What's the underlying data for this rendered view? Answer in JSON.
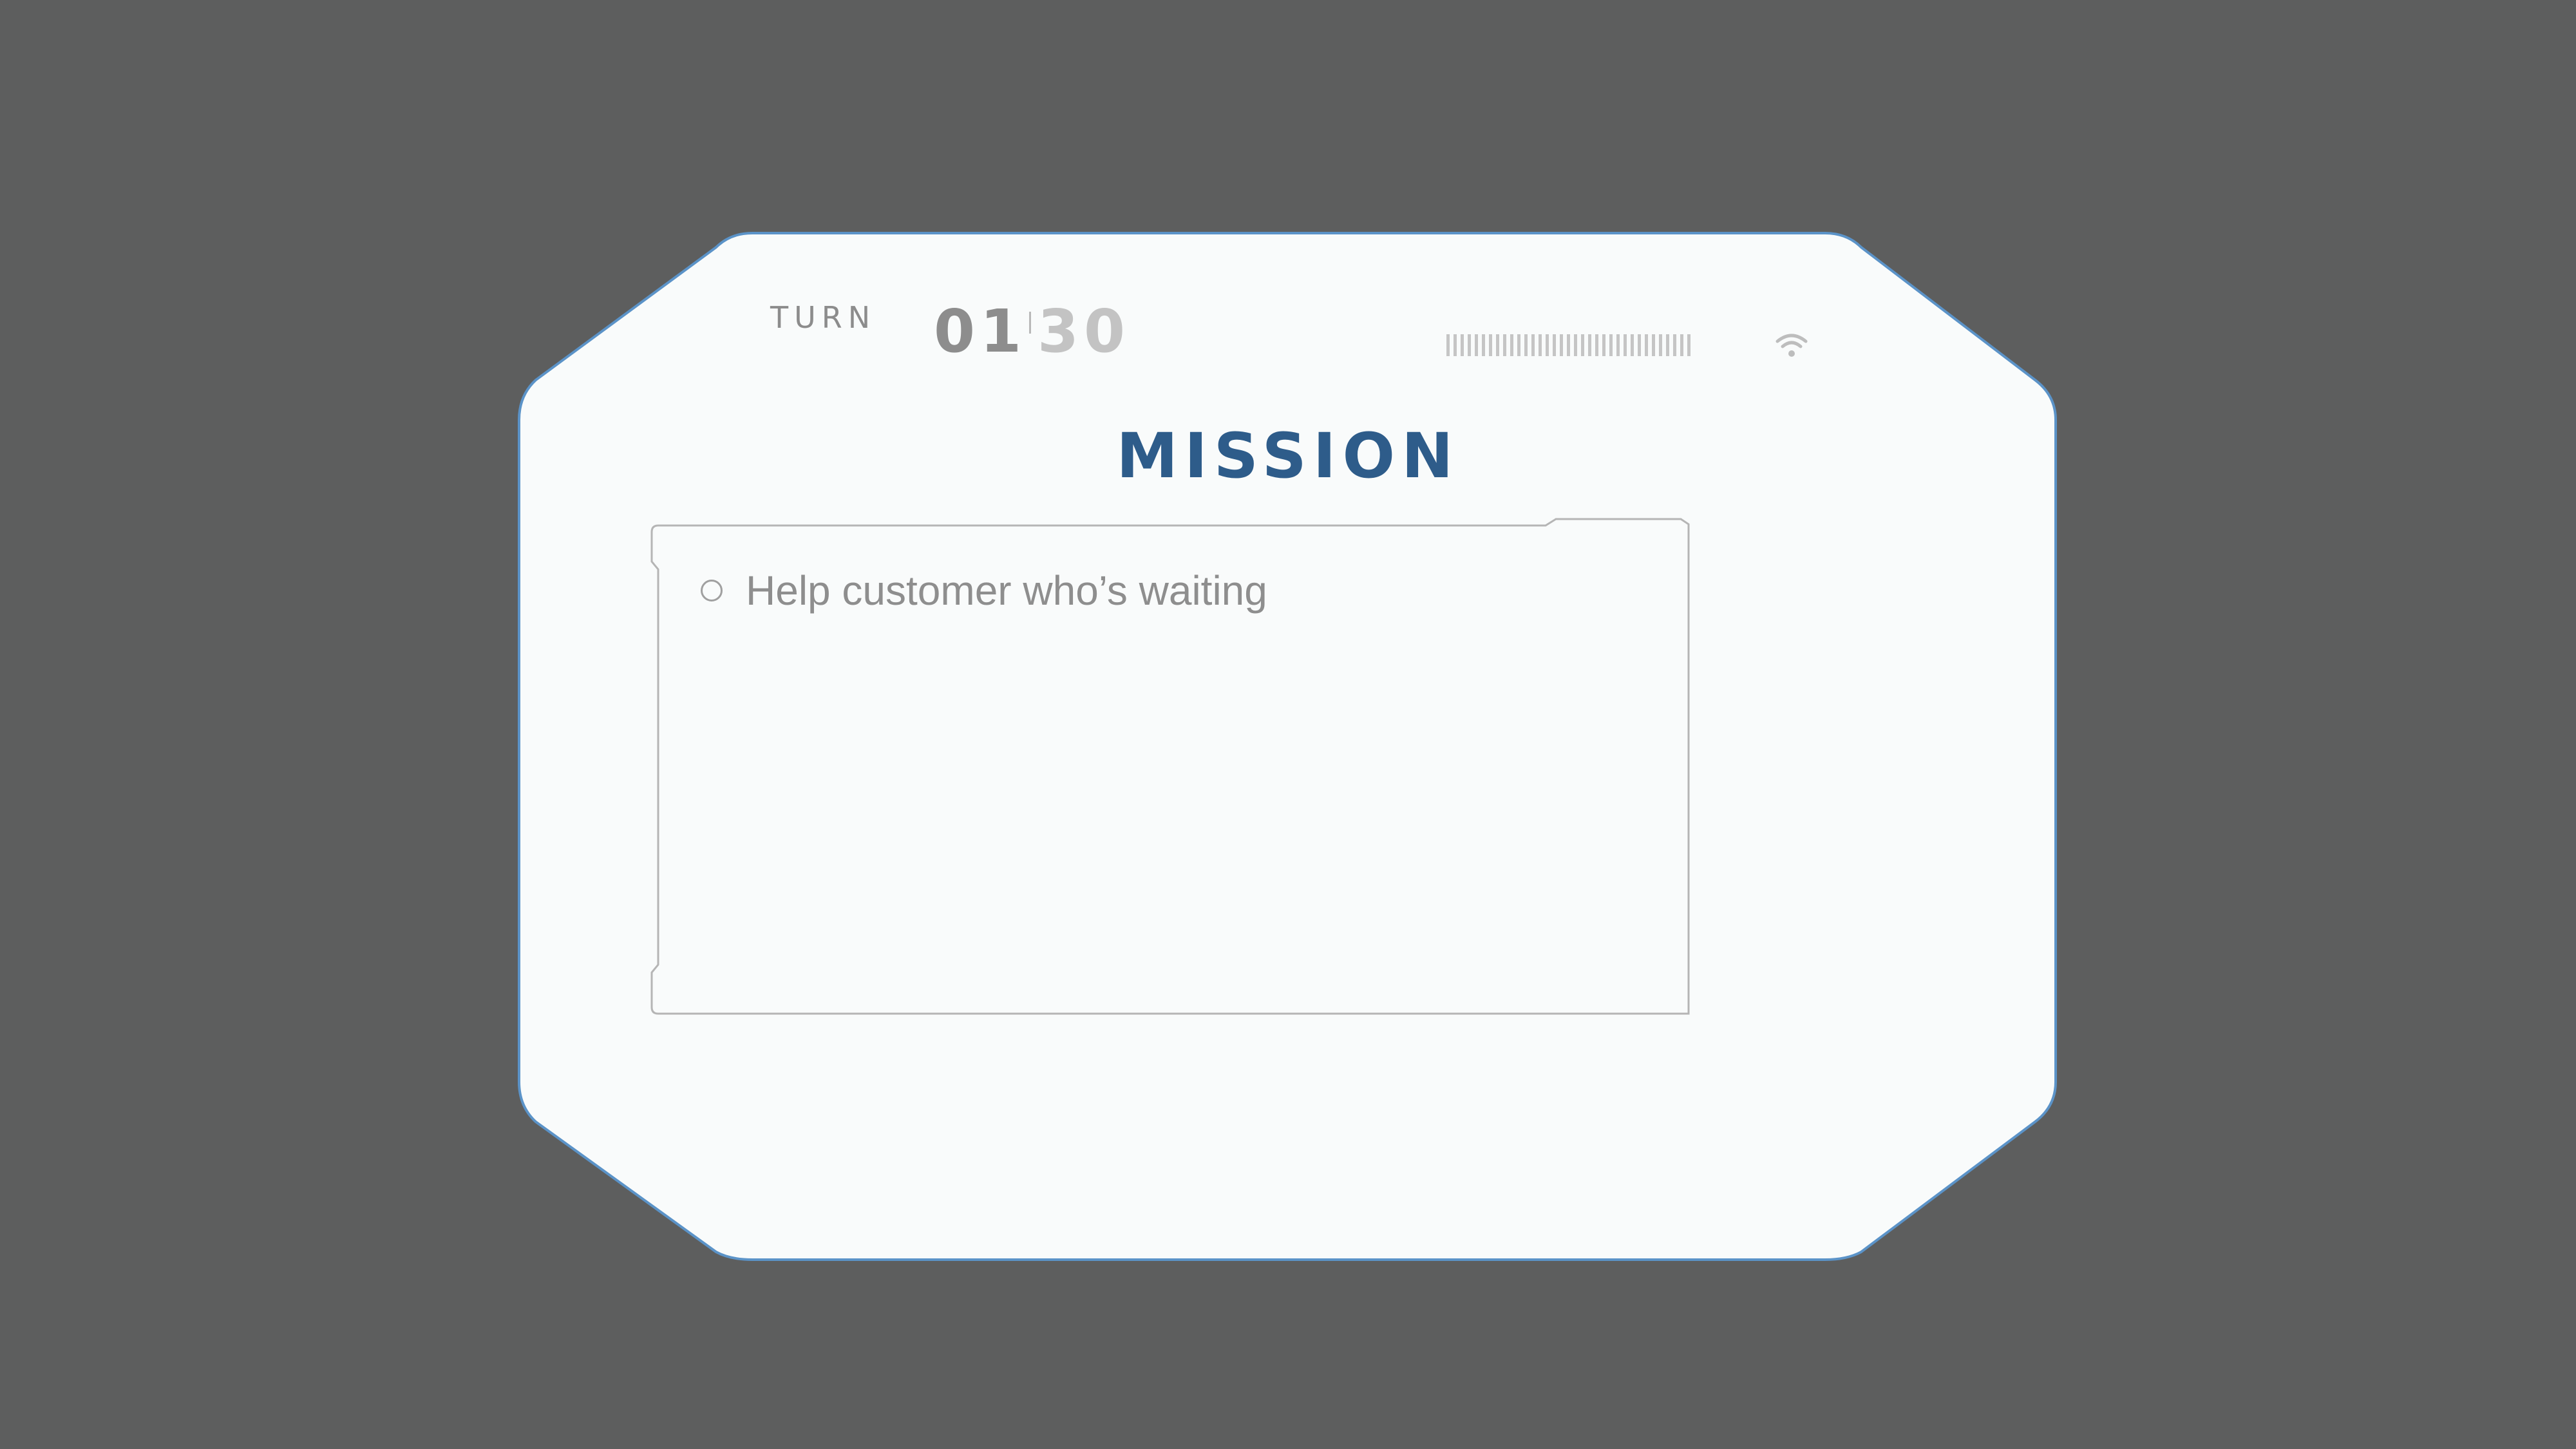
{
  "header": {
    "turn_label": "TURN",
    "turn_current": "01",
    "turn_total": "30",
    "signal_icon": "signal-strength-bars",
    "wifi_icon": "wifi-icon"
  },
  "mission": {
    "title": "MISSION",
    "items": [
      {
        "label": "Help customer who’s waiting",
        "checked": false
      }
    ]
  },
  "colors": {
    "background": "#5d5e5e",
    "panel": "#f9fbfb",
    "panel_border": "#5b93c8",
    "title": "#2e5c8a",
    "muted_text": "#8e8e8e"
  }
}
